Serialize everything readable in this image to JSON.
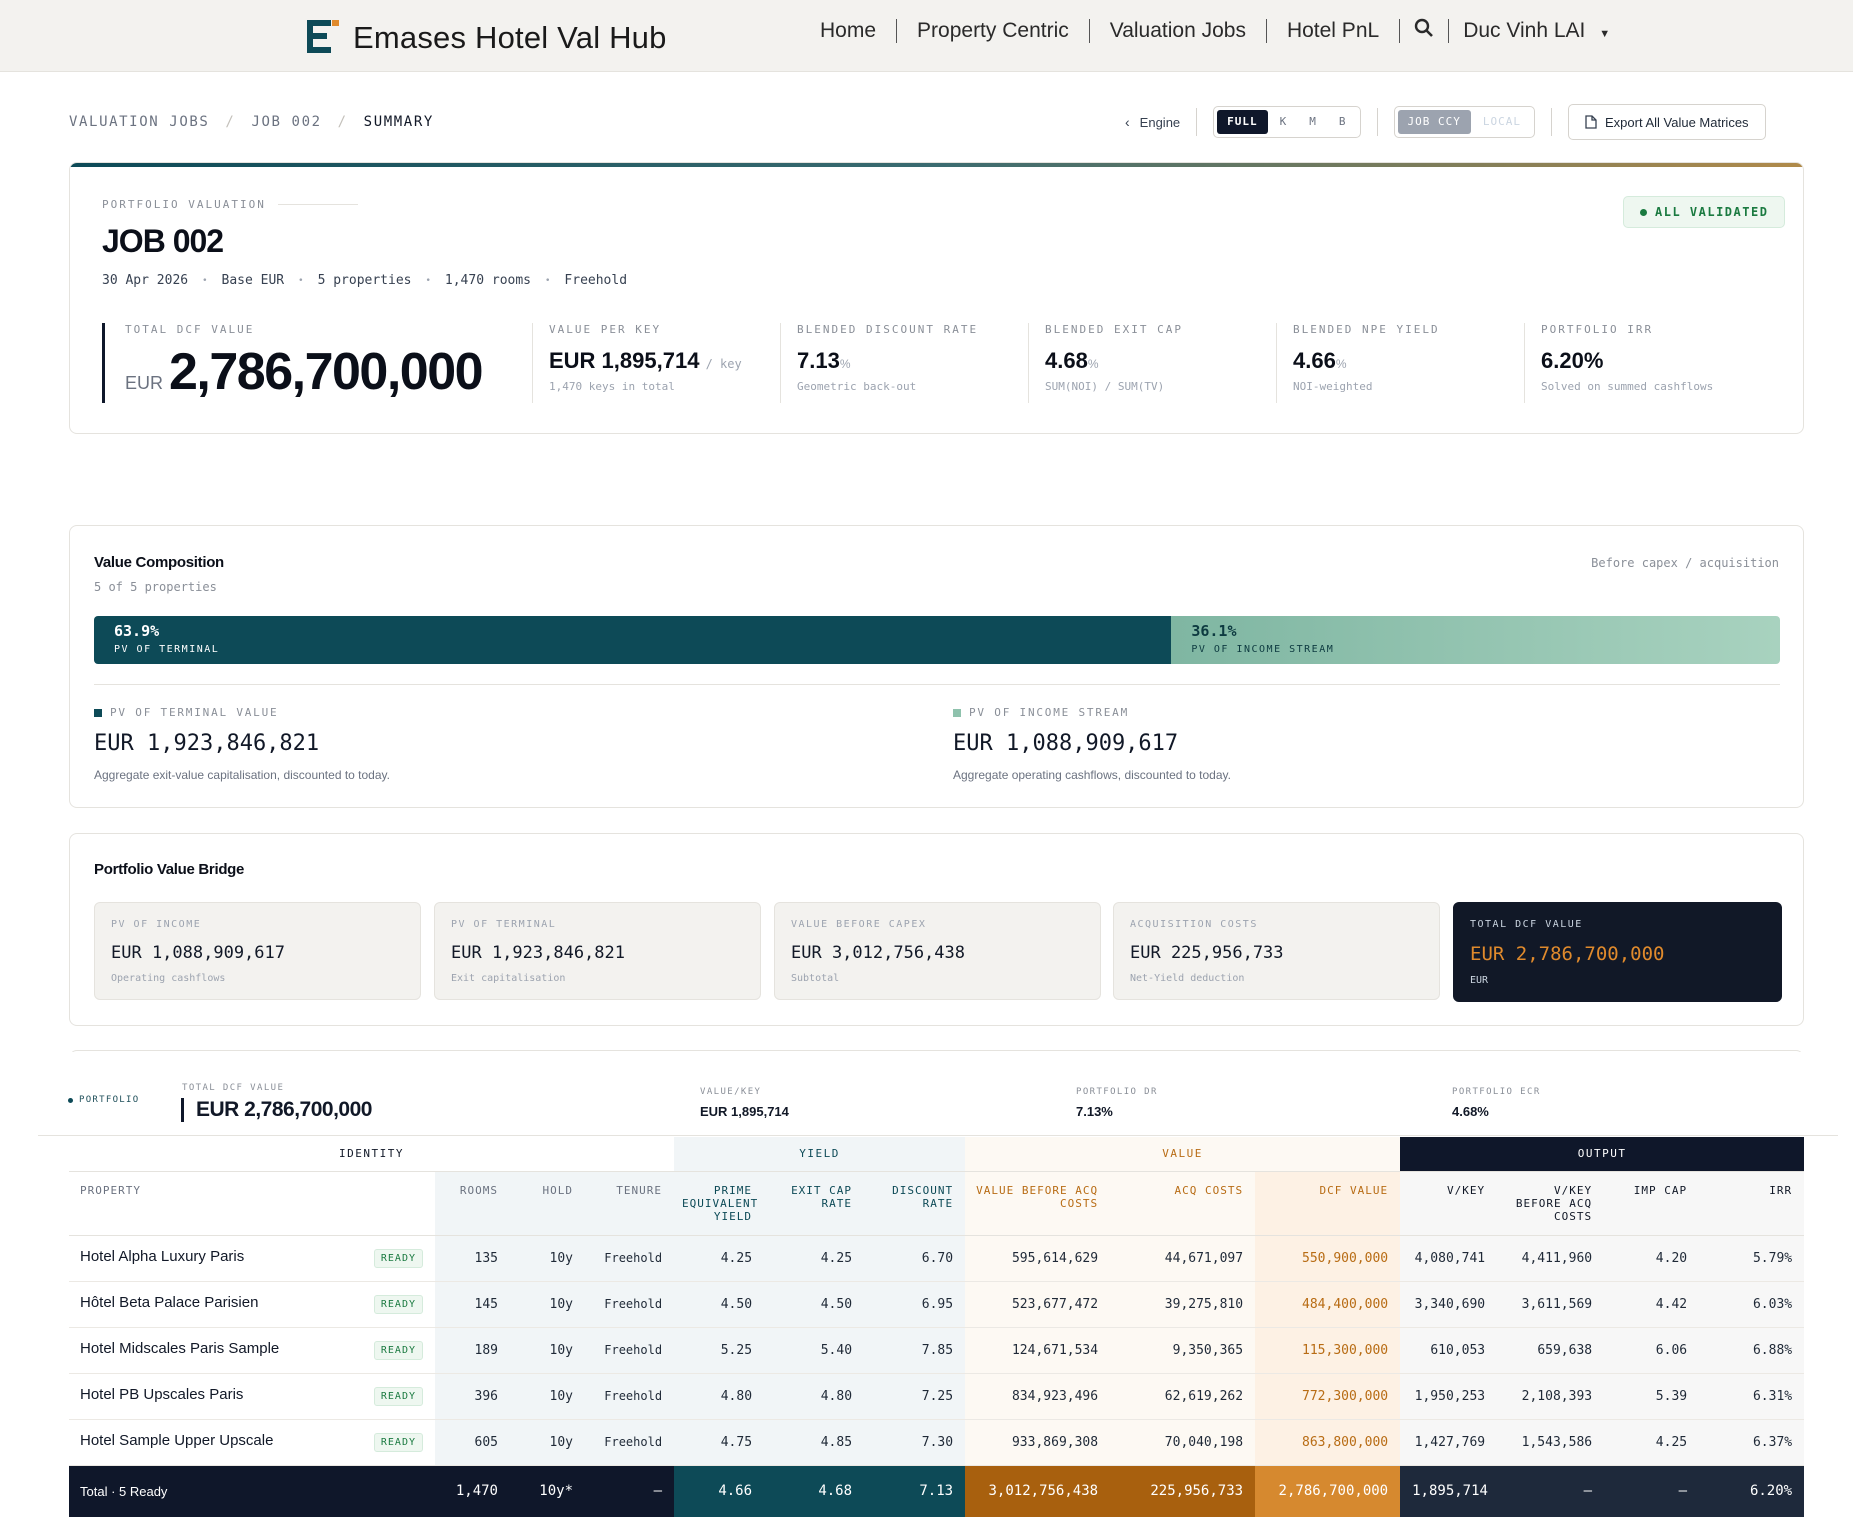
{
  "app": {
    "name": "Emases Hotel Val Hub"
  },
  "nav": {
    "links": [
      "Home",
      "Property Centric",
      "Valuation Jobs",
      "Hotel PnL"
    ],
    "user": "Duc Vinh LAI"
  },
  "breadcrumb": [
    "VALUATION JOBS",
    "JOB 002",
    "SUMMARY"
  ],
  "controls": {
    "engine": "Engine",
    "scale": [
      "FULL",
      "K",
      "M",
      "B"
    ],
    "currency": [
      "JOB CCY",
      "LOCAL"
    ],
    "export": "Export All Value Matrices"
  },
  "hero": {
    "eyebrow": "PORTFOLIO VALUATION",
    "title": "JOB 002",
    "status": "ALL VALIDATED",
    "meta": [
      "30 Apr 2026",
      "Base EUR",
      "5 properties",
      "1,470 rooms",
      "Freehold"
    ],
    "total": {
      "label": "TOTAL DCF VALUE",
      "ccy": "EUR",
      "value": "2,786,700,000"
    },
    "kpis": [
      {
        "label": "VALUE PER KEY",
        "value": "EUR 1,895,714",
        "unit": "/ key",
        "sub": "1,470 keys in total"
      },
      {
        "label": "BLENDED DISCOUNT RATE",
        "value": "7.13",
        "unit": "%",
        "sub": "Geometric back-out"
      },
      {
        "label": "BLENDED EXIT CAP",
        "value": "4.68",
        "unit": "%",
        "sub": "SUM(NOI) / SUM(TV)"
      },
      {
        "label": "BLENDED NPE YIELD",
        "value": "4.66",
        "unit": "%",
        "sub": "NOI-weighted"
      },
      {
        "label": "PORTFOLIO IRR",
        "value": "6.20%",
        "unit": "",
        "sub": "Solved on summed cashflows"
      }
    ]
  },
  "composition": {
    "title": "Value Composition",
    "sub": "5 of 5 properties",
    "note": "Before capex / acquisition",
    "terminal": {
      "pct": "63.9%",
      "share": 0.639,
      "bar_label": "PV OF TERMINAL",
      "label": "PV OF TERMINAL VALUE",
      "value": "EUR 1,923,846,821",
      "desc": "Aggregate exit-value capitalisation, discounted to today.",
      "color": "#0d4a57"
    },
    "income": {
      "pct": "36.1%",
      "share": 0.361,
      "bar_label": "PV OF INCOME STREAM",
      "label": "PV OF INCOME STREAM",
      "value": "EUR 1,088,909,617",
      "desc": "Aggregate operating cashflows, discounted to today.",
      "color": "#8fc2ad"
    }
  },
  "bridge": {
    "title": "Portfolio Value Bridge",
    "tiles": [
      {
        "t": "PV OF INCOME",
        "v": "EUR 1,088,909,617",
        "s": "Operating cashflows"
      },
      {
        "t": "PV OF TERMINAL",
        "v": "EUR 1,923,846,821",
        "s": "Exit capitalisation"
      },
      {
        "t": "VALUE BEFORE CAPEX",
        "v": "EUR 3,012,756,438",
        "s": "Subtotal"
      },
      {
        "t": "ACQUISITION COSTS",
        "v": "EUR 225,956,733",
        "s": "Net-Yield deduction"
      },
      {
        "t": "TOTAL DCF VALUE",
        "v": "EUR 2,786,700,000",
        "s": "EUR"
      }
    ]
  },
  "strip": {
    "tag": "PORTFOLIO",
    "total_label": "TOTAL DCF VALUE",
    "total": "EUR 2,786,700,000",
    "vkey_label": "VALUE/KEY",
    "vkey": "EUR 1,895,714",
    "dr_label": "PORTFOLIO DR",
    "dr": "7.13%",
    "ecr_label": "PORTFOLIO ECR",
    "ecr": "4.68%"
  },
  "table": {
    "groups": [
      "IDENTITY",
      "YIELD",
      "VALUE",
      "OUTPUT"
    ],
    "columns": [
      "PROPERTY",
      "ROOMS",
      "HOLD",
      "TENURE",
      "PRIME EQUIVALENT YIELD",
      "EXIT CAP RATE",
      "DISCOUNT RATE",
      "VALUE BEFORE ACQ COSTS",
      "ACQ COSTS",
      "DCF VALUE",
      "V/KEY",
      "V/KEY BEFORE ACQ COSTS",
      "IMP CAP",
      "IRR"
    ],
    "status": "READY",
    "rows": [
      [
        "Hotel Alpha Luxury Paris",
        "135",
        "10y",
        "Freehold",
        "4.25",
        "4.25",
        "6.70",
        "595,614,629",
        "44,671,097",
        "550,900,000",
        "4,080,741",
        "4,411,960",
        "4.20",
        "5.79%"
      ],
      [
        "Hôtel Beta Palace Parisien",
        "145",
        "10y",
        "Freehold",
        "4.50",
        "4.50",
        "6.95",
        "523,677,472",
        "39,275,810",
        "484,400,000",
        "3,340,690",
        "3,611,569",
        "4.42",
        "6.03%"
      ],
      [
        "Hotel Midscales Paris Sample",
        "189",
        "10y",
        "Freehold",
        "5.25",
        "5.40",
        "7.85",
        "124,671,534",
        "9,350,365",
        "115,300,000",
        "610,053",
        "659,638",
        "6.06",
        "6.88%"
      ],
      [
        "Hotel PB Upscales Paris",
        "396",
        "10y",
        "Freehold",
        "4.80",
        "4.80",
        "7.25",
        "834,923,496",
        "62,619,262",
        "772,300,000",
        "1,950,253",
        "2,108,393",
        "5.39",
        "6.31%"
      ],
      [
        "Hotel Sample Upper Upscale",
        "605",
        "10y",
        "Freehold",
        "4.75",
        "4.85",
        "7.30",
        "933,869,308",
        "70,040,198",
        "863,800,000",
        "1,427,769",
        "1,543,586",
        "4.25",
        "6.37%"
      ]
    ],
    "total": [
      "Total · 5 Ready",
      "1,470",
      "10y*",
      "—",
      "4.66",
      "4.68",
      "7.13",
      "3,012,756,438",
      "225,956,733",
      "2,786,700,000",
      "1,895,714",
      "—",
      "—",
      "6.20%"
    ]
  },
  "colors": {
    "navy": "#0f172a",
    "teal": "#0d4a57",
    "orange": "#e08a2c",
    "green": "#1a7a40"
  }
}
